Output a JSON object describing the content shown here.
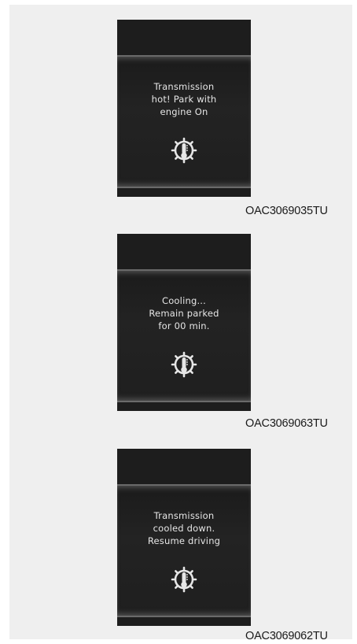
{
  "panels": [
    {
      "lines": [
        "Transmission",
        "hot! Park with",
        "engine On"
      ],
      "icon": "transmission-temperature-icon",
      "code": "OAC3069035TU"
    },
    {
      "lines": [
        "Cooling...",
        "Remain parked",
        "for 00 min."
      ],
      "icon": "transmission-temperature-icon",
      "code": "OAC3069063TU"
    },
    {
      "lines": [
        "Transmission",
        "cooled down.",
        "Resume driving"
      ],
      "icon": "transmission-temperature-icon",
      "code": "OAC3069062TU"
    }
  ]
}
